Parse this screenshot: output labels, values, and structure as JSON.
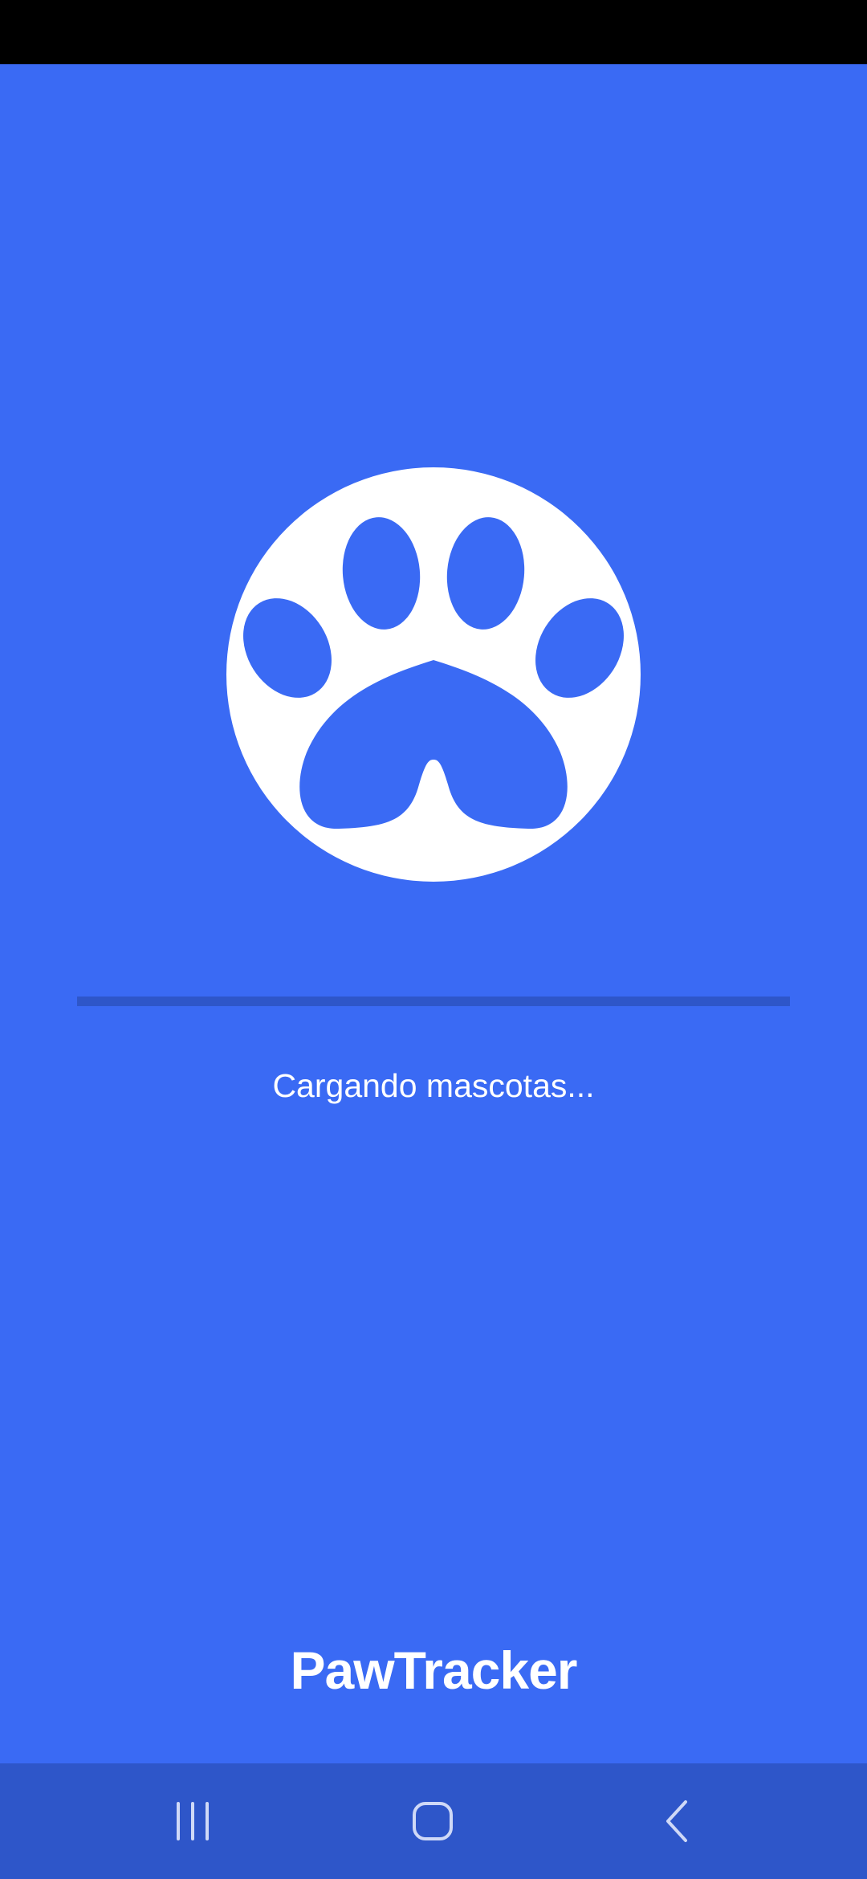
{
  "status_bar": {},
  "splash": {
    "logo_icon": "paw-print-icon",
    "loading_text": "Cargando mascotas...",
    "progress_fraction": 0,
    "app_name": "PawTracker"
  },
  "navigation_bar": {
    "recents_icon": "recent-apps-icon",
    "home_icon": "home-icon",
    "back_icon": "back-icon"
  },
  "colors": {
    "background": "#3a6af4",
    "progress_track": "#2e56c9",
    "nav_bar": "#2e56c9",
    "foreground": "#ffffff"
  }
}
